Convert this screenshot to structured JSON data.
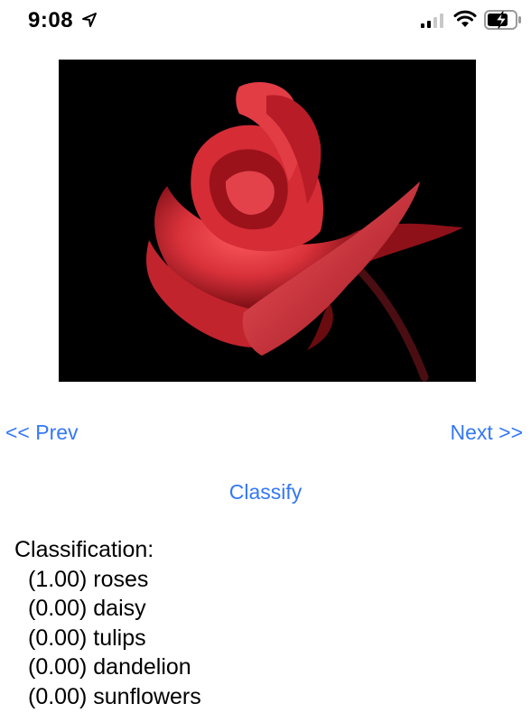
{
  "status_bar": {
    "time": "9:08",
    "icons": [
      "location-arrow-icon",
      "cellular-signal-icon",
      "wifi-icon",
      "battery-charging-icon"
    ]
  },
  "image": {
    "subject": "rose",
    "colors": {
      "petal": "#c81e2a",
      "background": "#000000",
      "stem": "#3a0a0c"
    }
  },
  "navigation": {
    "prev_label": "<< Prev",
    "next_label": "Next >>"
  },
  "classify_label": "Classify",
  "results": {
    "heading": "Classification:",
    "items": [
      {
        "score": "(1.00)",
        "label": "roses"
      },
      {
        "score": "(0.00)",
        "label": "daisy"
      },
      {
        "score": "(0.00)",
        "label": "tulips"
      },
      {
        "score": "(0.00)",
        "label": "dandelion"
      },
      {
        "score": "(0.00)",
        "label": "sunflowers"
      }
    ]
  },
  "accent_color": "#3478f6"
}
